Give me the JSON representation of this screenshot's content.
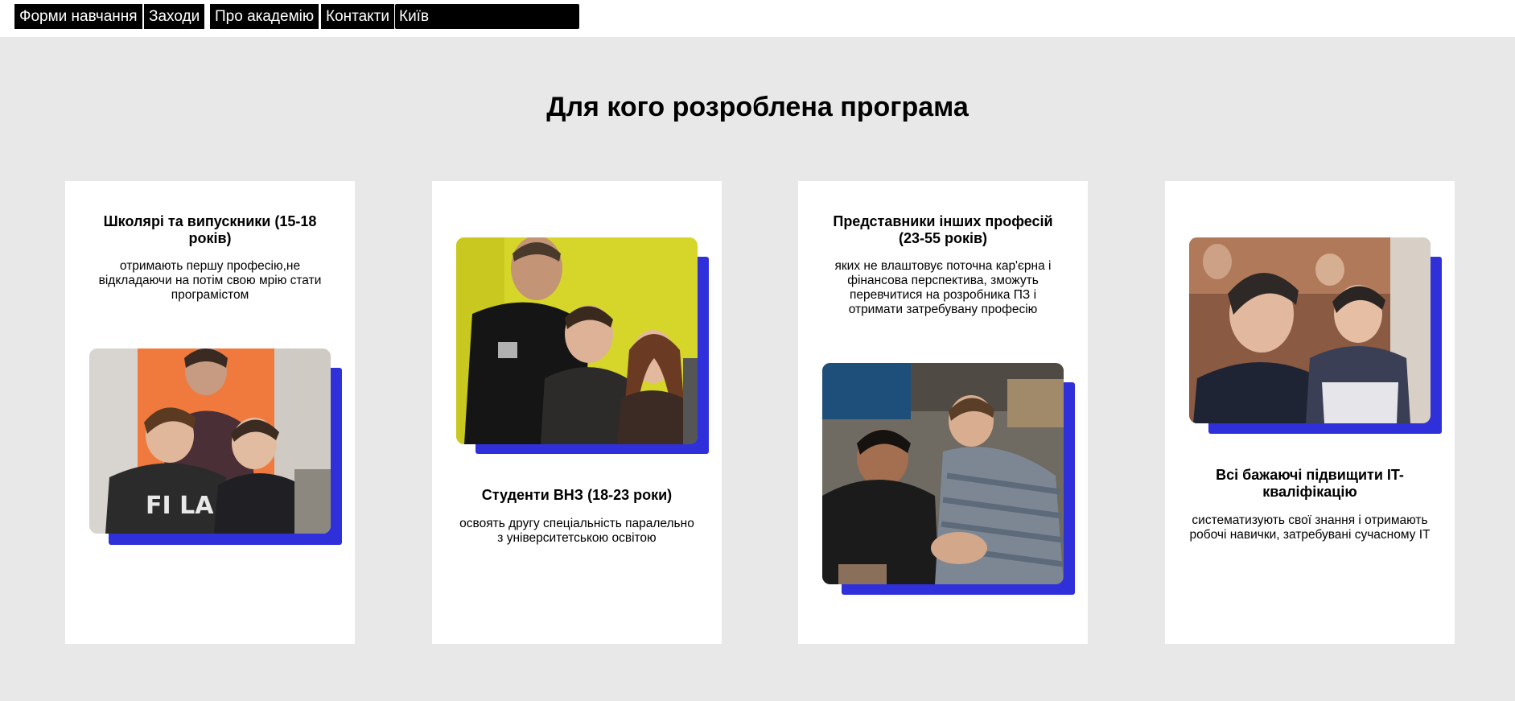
{
  "nav": {
    "items": [
      "Форми навчання",
      "Заходи",
      "Про академію",
      "Контакти"
    ],
    "city": "Київ"
  },
  "section": {
    "title": "Для кого розроблена програма"
  },
  "cards": [
    {
      "title": "Школярі та випускники (15-18 років)",
      "description": "отримають першу професію,не відкладаючи на потім свою мрію стати програмістом"
    },
    {
      "title": "Студенти ВНЗ (18-23 роки)",
      "description": "освоять другу спеціальність паралельно з університетською освітою"
    },
    {
      "title": "Представники інших професій (23-55 років)",
      "description": "яких не влаштовує поточна кар'єрна і фінансова перспектива, зможуть перевчитися на розробника ПЗ і отримати затребувану професію"
    },
    {
      "title": "Всі бажаючі підвищити IT-кваліфікацію",
      "description": "систематизують свої знання і отримають робочі навички, затребувані сучасному IT"
    }
  ],
  "colors": {
    "accent": "#3030db",
    "background": "#e8e8e8",
    "card": "#ffffff",
    "nav": "#000000"
  }
}
